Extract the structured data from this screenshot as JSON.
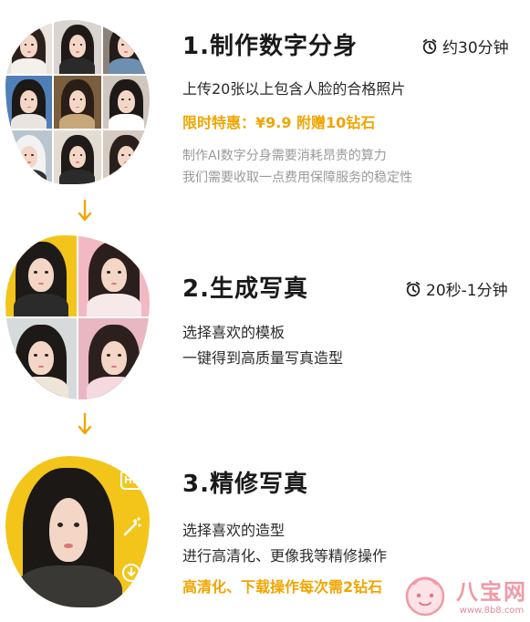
{
  "steps": [
    {
      "title": "1.制作数字分身",
      "time": "约30分钟",
      "lines": [
        "上传20张以上包含人脸的合格照片"
      ],
      "highlight": "限时特惠：¥9.9 附赠10钻石",
      "notes": [
        "制作AI数字分身需要消耗昂贵的算力",
        "我们需要收取一点费用保障服务的稳定性"
      ]
    },
    {
      "title": "2.生成写真",
      "time": "20秒-1分钟",
      "lines": [
        "选择喜欢的模板",
        "一键得到高质量写真造型"
      ]
    },
    {
      "title": "3.精修写真",
      "lines": [
        "选择喜欢的造型",
        "进行高清化、更像我等精修操作"
      ],
      "highlight": "高清化、下载操作每次需2钻石"
    }
  ],
  "side_icons": {
    "hd_label": "HD",
    "magic": "magic-wand-icon",
    "download": "download-icon"
  },
  "watermark": {
    "cn": "八宝网",
    "url": "www.8b8.com"
  },
  "colors": {
    "accent": "#f0a500",
    "yellow": "#f3c51b",
    "pink": "#f3b6bf"
  }
}
